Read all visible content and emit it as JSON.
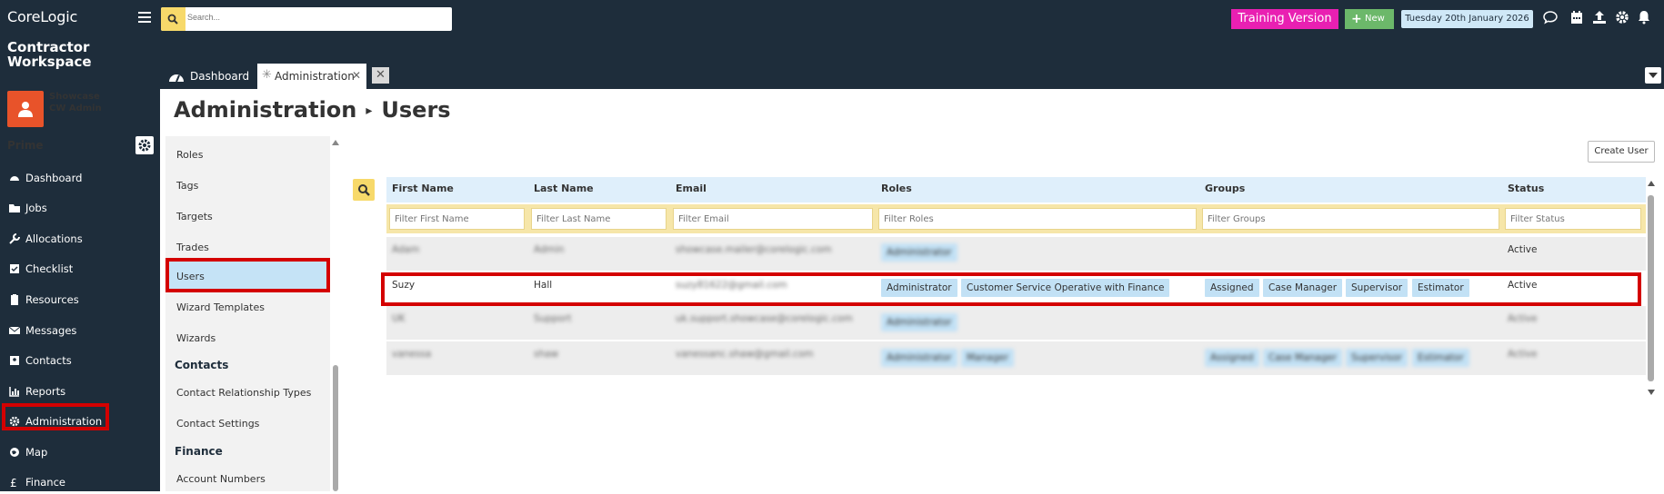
{
  "app": {
    "logo_top": "CoreLogic",
    "logo_bottom": "Contractor Workspace",
    "user_name": "Showcase",
    "user_role": "CW Admin",
    "section": "Prime"
  },
  "sidebar": {
    "items": [
      {
        "label": "Dashboard",
        "icon": "dashboard-icon"
      },
      {
        "label": "Jobs",
        "icon": "folder-icon"
      },
      {
        "label": "Allocations",
        "icon": "wrench-icon"
      },
      {
        "label": "Checklist",
        "icon": "checkbox-icon"
      },
      {
        "label": "Resources",
        "icon": "clipboard-icon"
      },
      {
        "label": "Messages",
        "icon": "envelope-icon"
      },
      {
        "label": "Contacts",
        "icon": "address-book-icon"
      },
      {
        "label": "Reports",
        "icon": "chart-icon"
      },
      {
        "label": "Administration",
        "icon": "gear-icon"
      },
      {
        "label": "Map",
        "icon": "globe-icon"
      },
      {
        "label": "Finance",
        "icon": "pound-icon"
      }
    ]
  },
  "header": {
    "search_placeholder": "Search...",
    "training_label": "Training Version",
    "new_label": "New",
    "date": "Tuesday 20th January 2026",
    "colors": {
      "training": "#e920b2",
      "new": "#6cb86a",
      "sidebar": "#1e2d3b"
    }
  },
  "tabs": {
    "dashboard": "Dashboard",
    "administration": "Administration"
  },
  "page": {
    "title": "Administration",
    "subtitle": "Users",
    "create_user": "Create User"
  },
  "subnav": {
    "items": [
      "Roles",
      "Tags",
      "Targets",
      "Trades",
      "Users",
      "Wizard Templates",
      "Wizards"
    ],
    "contacts_heading": "Contacts",
    "contacts_items": [
      "Contact Relationship Types",
      "Contact Settings"
    ],
    "finance_heading": "Finance",
    "finance_items": [
      "Account Numbers"
    ]
  },
  "grid": {
    "columns": [
      "First Name",
      "Last Name",
      "Email",
      "Roles",
      "Groups",
      "Status"
    ],
    "filters": [
      "Filter First Name",
      "Filter Last Name",
      "Filter Email",
      "Filter Roles",
      "Filter Groups",
      "Filter Status"
    ],
    "rows": [
      {
        "first": "Adam",
        "last": "Admin",
        "email": "showcase.mailer@corelogic.com",
        "roles": [
          "Administrator"
        ],
        "groups": [],
        "status": "Active"
      },
      {
        "first": "Suzy",
        "last": "Hall",
        "email": "suzy81622@gmail.com",
        "roles": [
          "Administrator",
          "Customer Service Operative with Finance"
        ],
        "groups": [
          "Assigned",
          "Case Manager",
          "Supervisor",
          "Estimator"
        ],
        "status": "Active"
      },
      {
        "first": "UK",
        "last": "Support",
        "email": "uk.support.showcase@corelogic.com",
        "roles": [
          "Administrator"
        ],
        "groups": [],
        "status": "Active"
      },
      {
        "first": "vanessa",
        "last": "shaw",
        "email": "vanessanc.shaw@gmail.com",
        "roles": [
          "Administrator",
          "Manager"
        ],
        "groups": [
          "Assigned",
          "Case Manager",
          "Supervisor",
          "Estimator"
        ],
        "status": "Active"
      }
    ]
  }
}
